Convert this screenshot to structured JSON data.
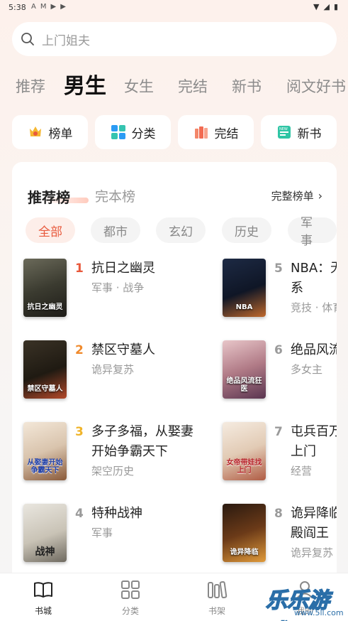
{
  "status_bar": {
    "time": "5:38",
    "left_icons": [
      "A",
      "M",
      "▶",
      "▶"
    ],
    "right_icons": [
      "▼",
      "◢",
      "▮"
    ]
  },
  "search": {
    "placeholder": "上门姐夫"
  },
  "channel_tabs": [
    "推荐",
    "男生",
    "女生",
    "完结",
    "新书",
    "阅文好书"
  ],
  "active_channel": "男生",
  "shortcuts": [
    {
      "label": "榜单",
      "icon": "crown-badge-icon"
    },
    {
      "label": "分类",
      "icon": "grid-icon"
    },
    {
      "label": "完结",
      "icon": "books-icon"
    },
    {
      "label": "新书",
      "icon": "new-book-icon"
    }
  ],
  "rank": {
    "tabs": [
      "推荐榜",
      "完本榜"
    ],
    "full_link": "完整榜单",
    "filters": [
      "全部",
      "都市",
      "玄幻",
      "历史",
      "军事"
    ],
    "books": [
      {
        "rank": "1",
        "title": "抗日之幽灵",
        "tags": "军事 · 战争",
        "cover_text": "抗日之幽灵"
      },
      {
        "rank": "2",
        "title": "禁区守墓人",
        "tags": "诡异复苏",
        "cover_text": "禁区守墓人"
      },
      {
        "rank": "3",
        "title": "多子多福，从娶妻开始争霸天下",
        "tags": "架空历史",
        "cover_text": "从娶妻开始争霸天下"
      },
      {
        "rank": "4",
        "title": "特种战神",
        "tags": "军事",
        "cover_text": "战神"
      },
      {
        "rank": "5",
        "title": "NBA：无敌三分体系",
        "tags": "竞技 · 体育",
        "cover_text": "NBA"
      },
      {
        "rank": "6",
        "title": "绝品风流狂医",
        "tags": "多女主",
        "cover_text": "绝品风流狂医"
      },
      {
        "rank": "7",
        "title": "屯兵百万，带娃找上门",
        "tags": "经营",
        "cover_text": "女帝带娃找上门"
      },
      {
        "rank": "8",
        "title": "诡异降临，我是十殿阎王",
        "tags": "诡异复苏",
        "cover_text": "诡异降临"
      }
    ]
  },
  "bottom_nav": [
    {
      "label": "书城",
      "icon": "open-book-icon"
    },
    {
      "label": "分类",
      "icon": "category-grid-icon"
    },
    {
      "label": "书架",
      "icon": "bookshelf-icon"
    },
    {
      "label": "我的",
      "icon": "profile-icon"
    }
  ],
  "watermark": {
    "text": "乐乐游戏",
    "url": "www.5ll.com"
  },
  "colors": {
    "accent": "#e8593c",
    "rank_1": "#e8593c",
    "rank_2": "#f08a2c",
    "rank_3": "#f0b429",
    "rank_other": "#9a9a9a"
  }
}
